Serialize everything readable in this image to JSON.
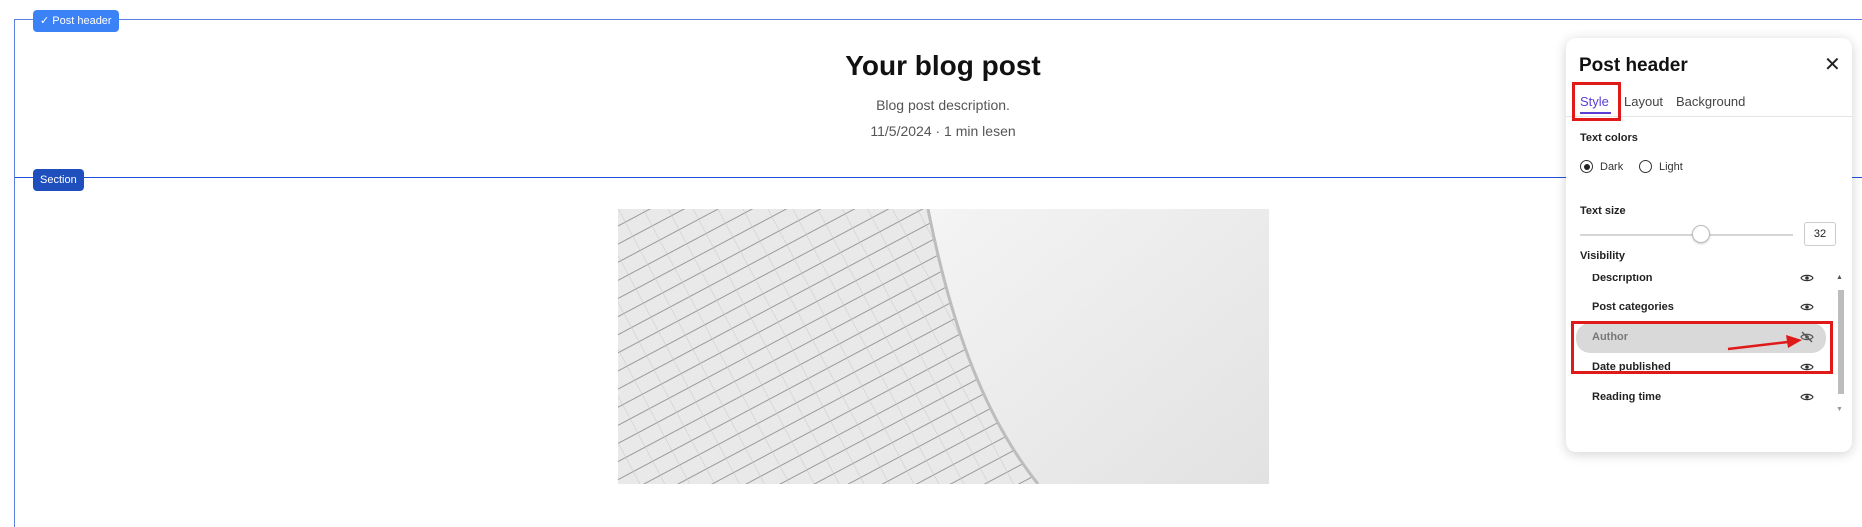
{
  "editor": {
    "post_header_tag": "✓ Post header",
    "section_tag": "Section"
  },
  "blog": {
    "title": "Your blog post",
    "description": "Blog post description.",
    "meta": "11/5/2024 · 1 min lesen"
  },
  "panel": {
    "title": "Post header",
    "close_icon": "close-icon",
    "tabs": [
      {
        "label": "Style",
        "active": true
      },
      {
        "label": "Layout",
        "active": false
      },
      {
        "label": "Background",
        "active": false
      }
    ],
    "text_colors_label": "Text colors",
    "text_colors_options": [
      {
        "label": "Dark",
        "selected": true
      },
      {
        "label": "Light",
        "selected": false
      }
    ],
    "text_size_label": "Text size",
    "text_size_value": "32",
    "visibility_label": "Visibility",
    "visibility_items": [
      {
        "label": "Description",
        "visible": true
      },
      {
        "label": "Post categories",
        "visible": true
      },
      {
        "label": "Author",
        "visible": false
      },
      {
        "label": "Date published",
        "visible": true
      },
      {
        "label": "Reading time",
        "visible": true
      }
    ]
  },
  "colors": {
    "accent": "#5b3fd6",
    "highlight": "#e01919",
    "tag_blue": "#3b82f6",
    "section_blue": "#1e4fbd"
  }
}
